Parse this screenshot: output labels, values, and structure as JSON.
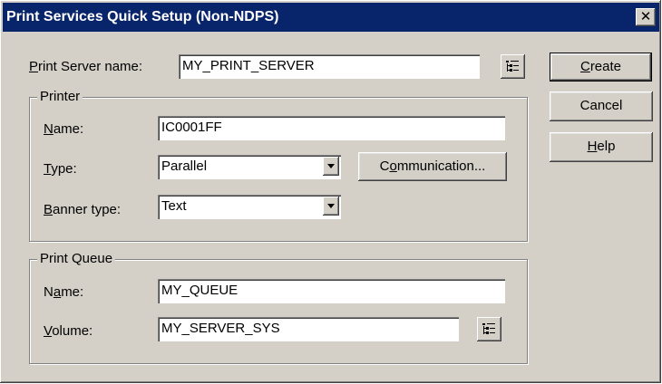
{
  "window": {
    "title": "Print Services Quick Setup (Non-NDPS)",
    "close_glyph": "✕"
  },
  "print_server": {
    "label_accel": "P",
    "label_rest": "rint Server name:",
    "value": "MY_PRINT_SERVER"
  },
  "printer_group": {
    "title": "Printer",
    "name_label_accel": "N",
    "name_label_rest": "ame:",
    "name_value": "IC0001FF",
    "type_label_accel": "T",
    "type_label_rest": "ype:",
    "type_value": "Parallel",
    "banner_label_accel": "B",
    "banner_label_rest": "anner type:",
    "banner_value": "Text",
    "comm_pre": "C",
    "comm_accel": "o",
    "comm_rest": "mmunication..."
  },
  "queue_group": {
    "title": "Print Queue",
    "name_pre": "N",
    "name_accel": "a",
    "name_rest": "me:",
    "name_value": "MY_QUEUE",
    "volume_accel": "V",
    "volume_rest": "olume:",
    "volume_value": "MY_SERVER_SYS"
  },
  "buttons": {
    "create_accel": "C",
    "create_rest": "reate",
    "cancel": "Cancel",
    "help_accel": "H",
    "help_rest": "elp"
  },
  "icons": {
    "browse": "tree-browse-icon",
    "dropdown": "dropdown-arrow-icon"
  }
}
